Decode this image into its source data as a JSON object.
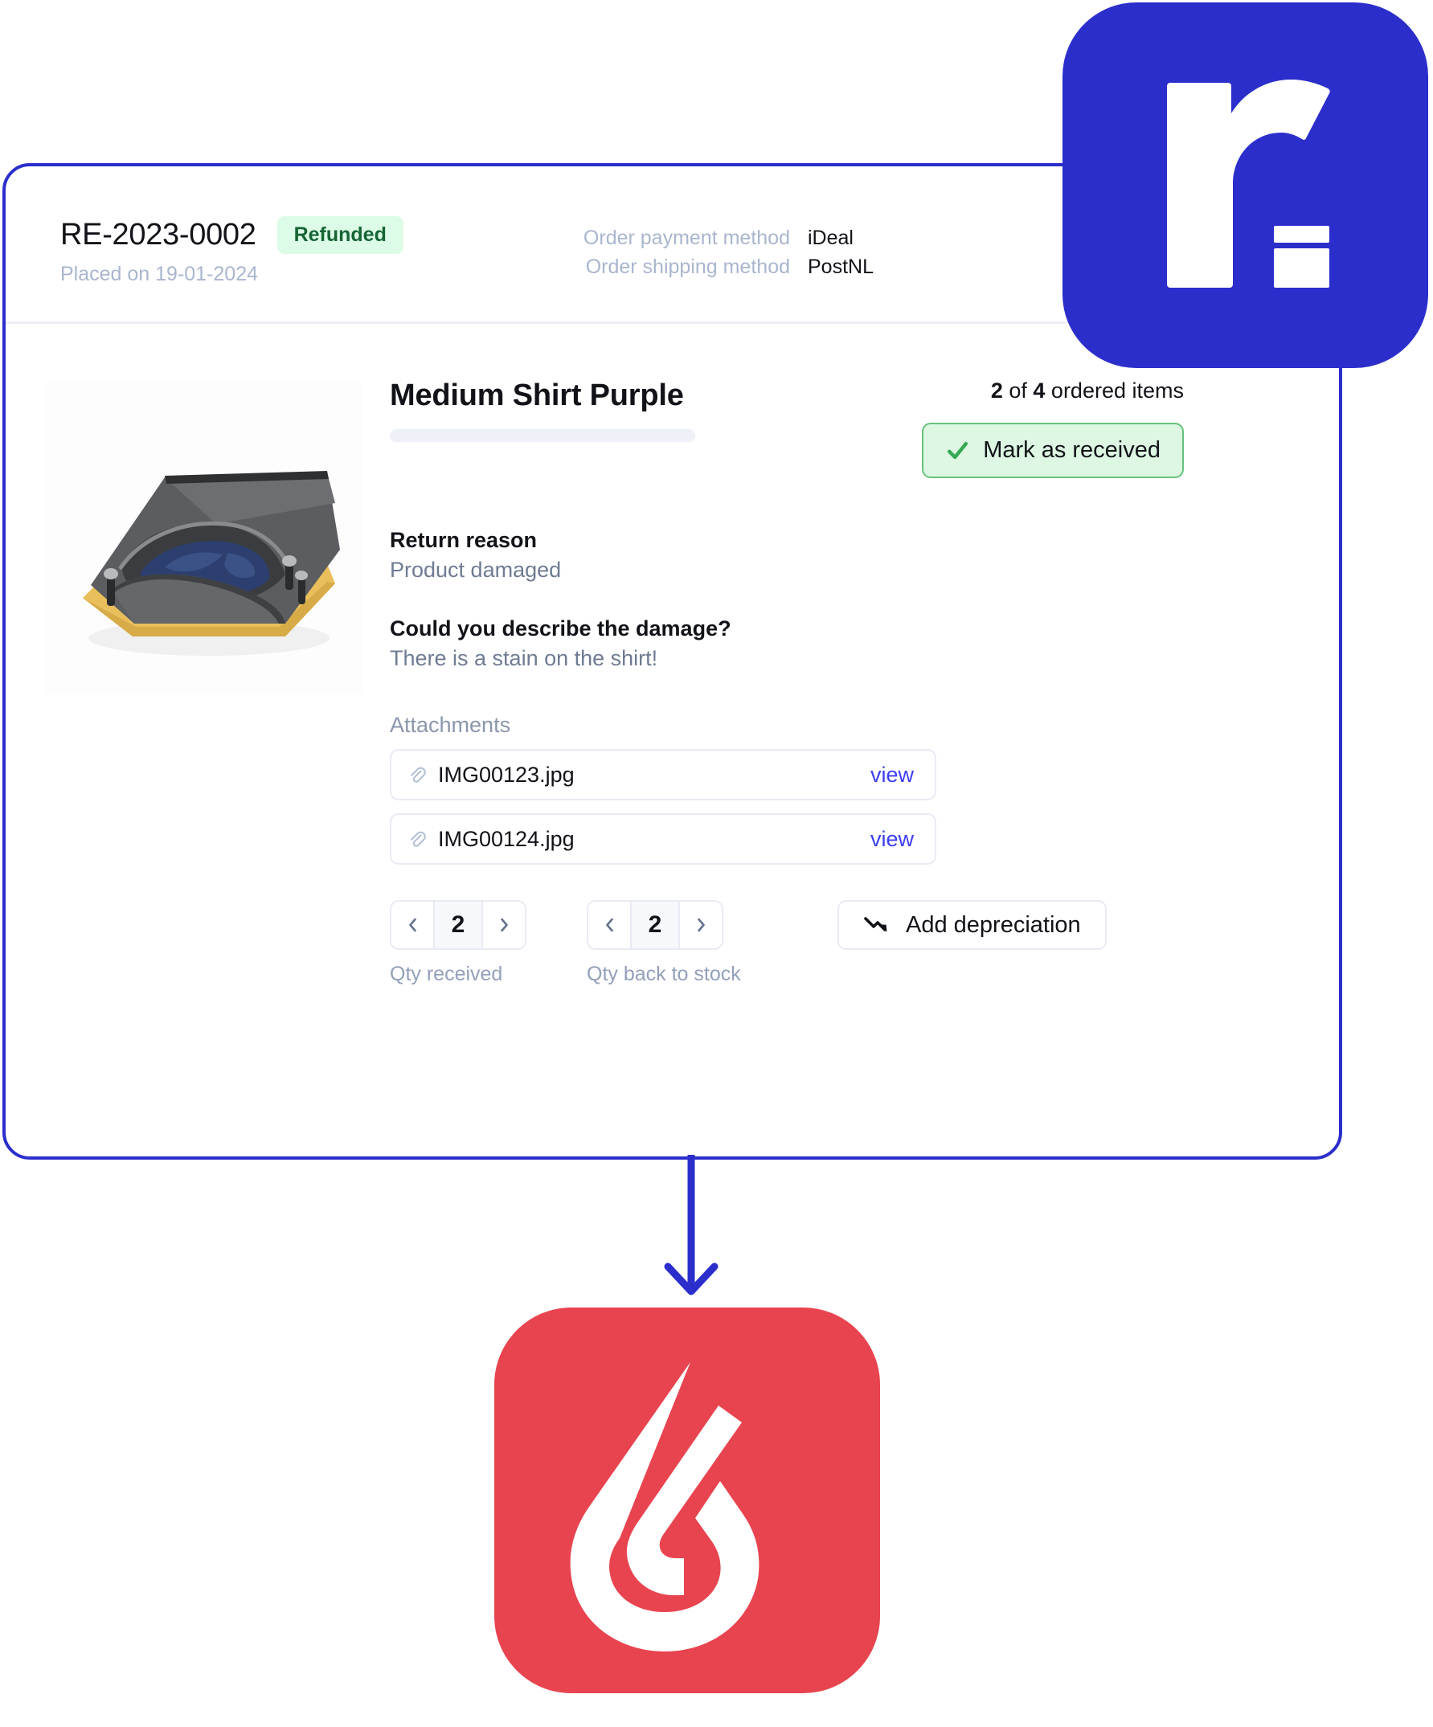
{
  "card": {
    "order_id": "RE-2023-0002",
    "status_badge": "Refunded",
    "placed_on": "Placed on 19-01-2024",
    "meta": [
      {
        "label": "Order payment method",
        "value": "iDeal"
      },
      {
        "label": "Order shipping method",
        "value": "PostNL"
      }
    ],
    "product": {
      "title": "Medium Shirt Purple",
      "ordered_count": "2",
      "ordered_total": "4",
      "ordered_items_prefix": " of ",
      "ordered_items_suffix": " ordered items",
      "mark_received_label": "Mark as received"
    },
    "return_reason": {
      "label": "Return reason",
      "value": "Product damaged"
    },
    "damage_question": {
      "label": "Could you describe the damage?",
      "value": "There is a stain on the shirt!"
    },
    "attachments": {
      "heading": "Attachments",
      "items": [
        {
          "name": "IMG00123.jpg",
          "action": "view"
        },
        {
          "name": "IMG00124.jpg",
          "action": "view"
        }
      ]
    },
    "steppers": [
      {
        "value": "2",
        "label": "Qty received",
        "prev": "‹",
        "next": "›"
      },
      {
        "value": "2",
        "label": "Qty back to stock",
        "prev": "‹",
        "next": "›"
      }
    ],
    "depreciation_label": "Add depreciation"
  },
  "icons": {
    "check": "check-icon",
    "paperclip": "paperclip-icon",
    "chevron_left": "chevron-left-icon",
    "chevron_right": "chevron-right-icon",
    "trend_down": "trend-down-arrow-icon",
    "returnless": "returnless-logo-icon",
    "lightspeed": "lightspeed-logo-icon",
    "arrow_down": "arrow-down-connector-icon",
    "product_photo": "product-photo"
  },
  "colors": {
    "brand_blue": "#2b2ecb",
    "link_blue": "#3d3df0",
    "badge_bg": "#dcfce7",
    "badge_text": "#166534",
    "success_border": "#67c27d",
    "lightspeed_red": "#e8444f",
    "muted_text": "#aab6ce",
    "body_text": "#111318"
  }
}
